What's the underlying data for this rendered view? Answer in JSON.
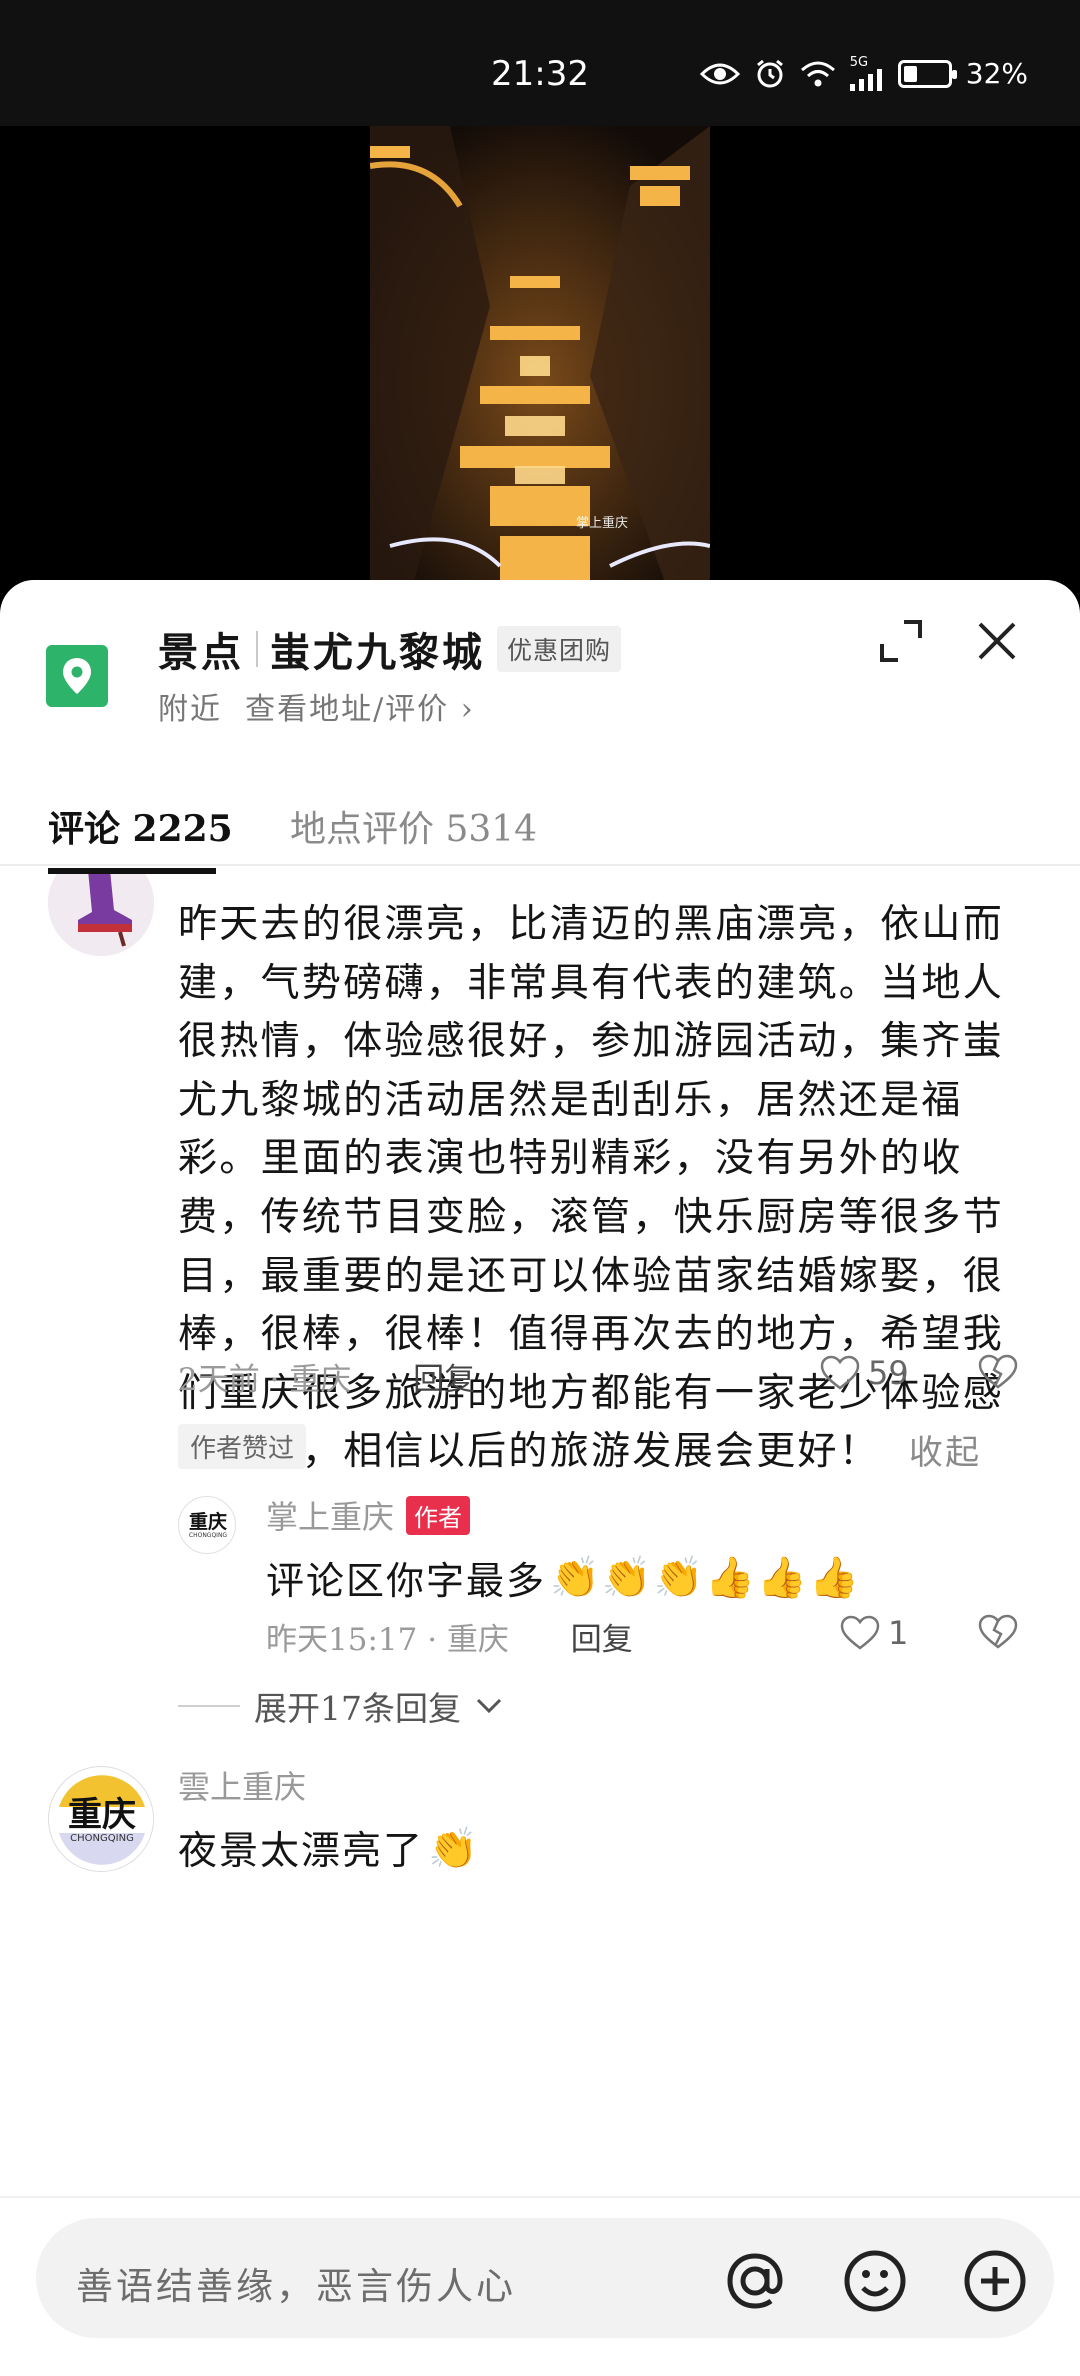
{
  "status_bar": {
    "time": "21:32",
    "network": "5G",
    "battery_percent": "32%",
    "battery_level": 0.32
  },
  "video": {
    "watermark": "掌上重庆"
  },
  "location": {
    "category": "景点",
    "name": "蚩尤九黎城",
    "deal_tag": "优惠团购",
    "subtitle": "附近  查看地址/评价",
    "pin_color": "#2db36a"
  },
  "tabs": [
    {
      "label": "评论 2225",
      "active": true
    },
    {
      "label": "地点评价 5314",
      "active": false
    }
  ],
  "comments": [
    {
      "user": "",
      "text": "昨天去的很漂亮，比清迈的黑庙漂亮，依山而建，气势磅礴，非常具有代表的建筑。当地人很热情，体验感很好，参加游园活动，集齐蚩尤九黎城的活动居然是刮刮乐，居然还是福彩。里面的表演也特别精彩，没有另外的收费，传统节目变脸，滚管，快乐厨房等很多节目，最重要的是还可以体验苗家结婚嫁娶，很棒，很棒，很棒！值得再次去的地方，希望我们重庆很多旅游的地方都能有一家老少体验感的地方，相信以后的旅游发展会更好！",
      "collapse_label": "收起",
      "meta": "2天前 · 重庆",
      "reply_label": "回复",
      "likes": "59",
      "author_liked": "作者赞过",
      "replies": [
        {
          "user": "掌上重庆",
          "badge": "作者",
          "avatar_text": "重庆",
          "avatar_sub": "CHONGQING",
          "text": "评论区你字最多",
          "emojis": "👏👏👏👍👍👍",
          "meta": "昨天15:17 · 重庆",
          "reply_label": "回复",
          "likes": "1"
        }
      ],
      "expand_label": "展开17条回复"
    },
    {
      "user": "雲上重庆",
      "avatar_text": "重庆",
      "avatar_sub": "CHONGQING",
      "text": "夜景太漂亮了",
      "emojis": "👏"
    }
  ],
  "composer": {
    "placeholder": "善语结善缘，恶言伤人心"
  },
  "icons": [
    "eye-icon",
    "alarm-icon",
    "wifi-icon",
    "signal-icon",
    "battery-icon",
    "location-pin-icon",
    "expand-icon",
    "close-icon",
    "heart-icon",
    "broken-heart-icon",
    "chevron-down-icon",
    "at-icon",
    "emoji-icon",
    "plus-icon"
  ]
}
